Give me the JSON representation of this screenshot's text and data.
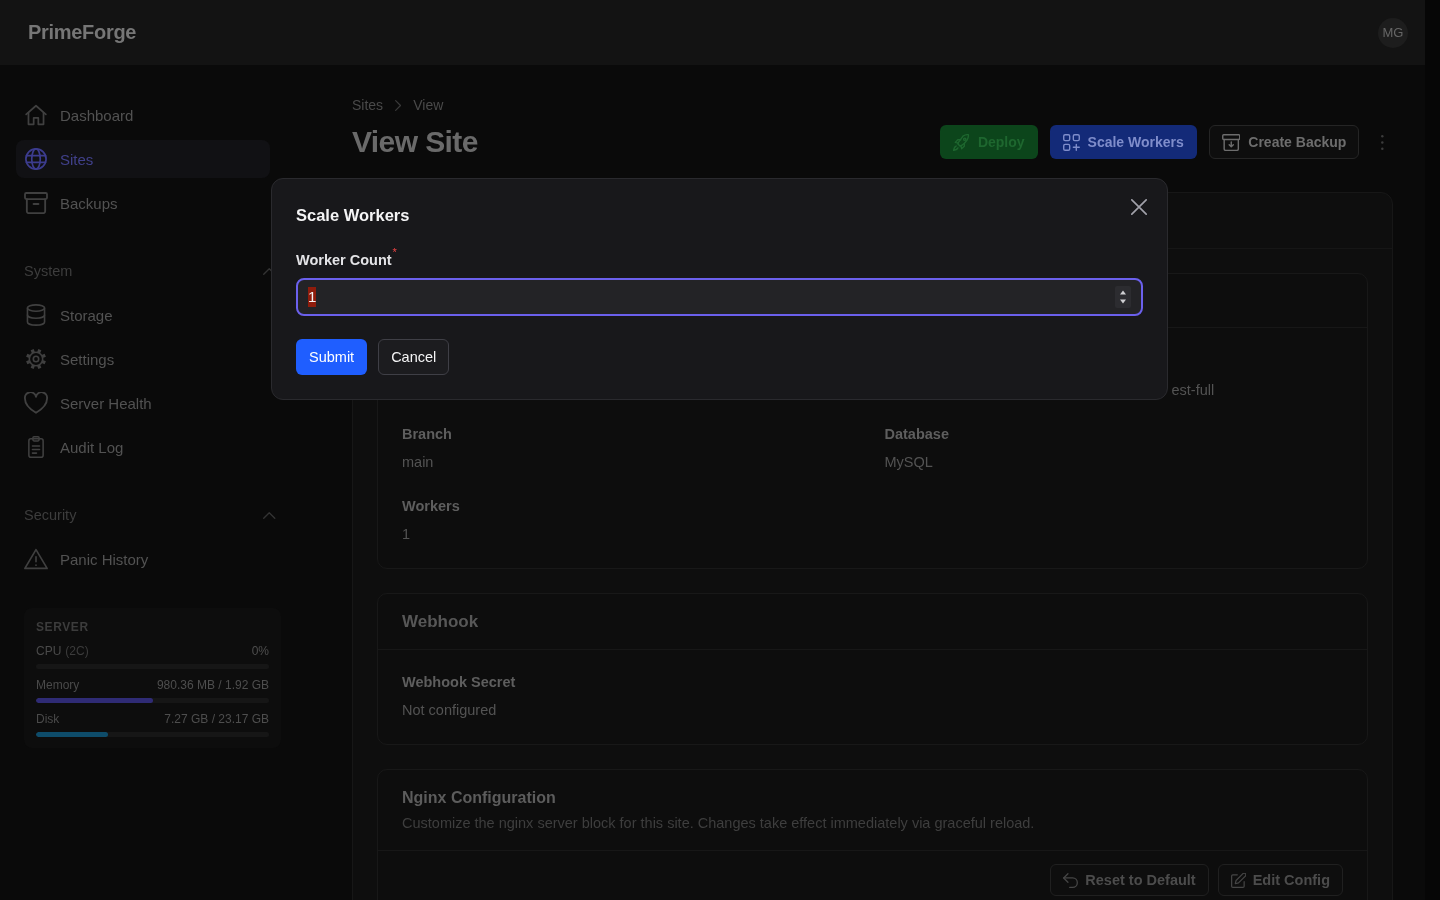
{
  "topbar": {
    "logo": "PrimeForge",
    "avatar": "MG"
  },
  "sidebar": {
    "groups": [
      {
        "items": [
          {
            "label": "Dashboard",
            "selected": false
          },
          {
            "label": "Sites",
            "selected": true
          },
          {
            "label": "Backups",
            "selected": false
          }
        ]
      },
      {
        "title": "System",
        "expanded": true,
        "items": [
          {
            "label": "Storage",
            "selected": false
          },
          {
            "label": "Settings",
            "selected": false
          },
          {
            "label": "Server Health",
            "selected": false
          },
          {
            "label": "Audit Log",
            "selected": false
          }
        ]
      },
      {
        "title": "Security",
        "expanded": true,
        "items": [
          {
            "label": "Panic History",
            "selected": false
          }
        ]
      }
    ],
    "server": {
      "title": "SERVER",
      "meters": [
        {
          "label": "CPU",
          "detail": "(2C)",
          "reading": "0%",
          "level": 0
        },
        {
          "label": "Memory",
          "reading": "980.36 MB / 1.92 GB",
          "level": 0.5,
          "color": "#2f2b75"
        },
        {
          "label": "Disk",
          "reading": "7.27 GB / 23.17 GB",
          "level": 0.31,
          "color": "#0e4c6a"
        }
      ]
    }
  },
  "breadcrumb": [
    "Sites",
    "View"
  ],
  "page_title": "View Site",
  "actions": [
    {
      "label": "Deploy",
      "kind": "success"
    },
    {
      "label": "Scale Workers",
      "kind": "primary"
    },
    {
      "label": "Create Backup",
      "kind": "outline"
    }
  ],
  "site_panel": {
    "details": {
      "fields": [
        {
          "kind": "tail",
          "value": "est-full"
        },
        {
          "kind": "full",
          "label": "Branch",
          "value": "main"
        },
        {
          "kind": "full",
          "label": "Database",
          "value": "MySQL"
        },
        {
          "kind": "full",
          "label": "Workers",
          "value": "1"
        }
      ]
    },
    "webhook": {
      "title": "Webhook",
      "fields": [
        {
          "kind": "full",
          "label": "Webhook Secret",
          "value": "Not configured"
        }
      ]
    },
    "nginx": {
      "title": "Nginx Configuration",
      "description": "Customize the nginx server block for this site. Changes take effect immediately via graceful reload.",
      "buttons": [
        {
          "label": "Reset to Default"
        },
        {
          "label": "Edit Config"
        }
      ]
    }
  },
  "modal": {
    "title": "Scale Workers",
    "field": {
      "label": "Worker Count",
      "required_mark": "*",
      "value": "1",
      "focused": true,
      "text_selected": true
    },
    "buttons": [
      {
        "label": "Submit",
        "kind": "primary"
      },
      {
        "label": "Cancel",
        "kind": "secondary"
      }
    ]
  }
}
